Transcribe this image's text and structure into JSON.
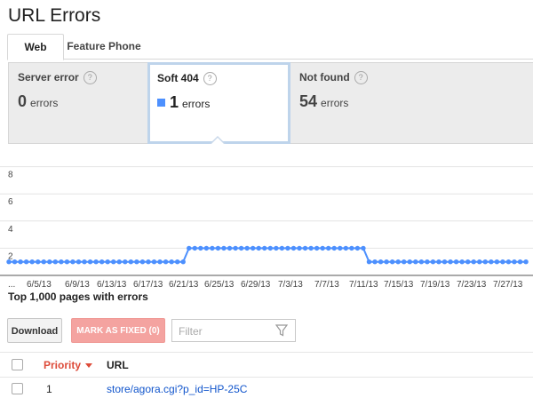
{
  "page": {
    "title": "URL Errors"
  },
  "tabs": [
    {
      "label": "Web",
      "active": true
    },
    {
      "label": "Feature Phone",
      "active": false
    }
  ],
  "summary": [
    {
      "label": "Server error",
      "value": "0",
      "unit": "errors",
      "selected": false
    },
    {
      "label": "Soft 404",
      "value": "1",
      "unit": "errors",
      "selected": true,
      "swatch_color": "#4d90fe"
    },
    {
      "label": "Not found",
      "value": "54",
      "unit": "errors",
      "selected": false
    }
  ],
  "help_glyph": "?",
  "chart_data": {
    "type": "line",
    "title": "",
    "xlabel": "",
    "ylabel": "",
    "ylim": [
      0,
      8
    ],
    "yticks": [
      "2",
      "4",
      "6",
      "8"
    ],
    "yticks_values": [
      2,
      4,
      6,
      8
    ],
    "xtick_labels": [
      "...",
      "6/5/13",
      "6/9/13",
      "6/13/13",
      "6/17/13",
      "6/21/13",
      "6/25/13",
      "6/29/13",
      "7/3/13",
      "7/7/13",
      "7/11/13",
      "7/15/13",
      "7/19/13",
      "7/23/13",
      "7/27/13"
    ],
    "grid": true,
    "color": "#4d90fe",
    "series": [
      {
        "values": [
          1,
          1,
          1,
          1,
          1,
          1,
          1,
          1,
          1,
          1,
          1,
          1,
          1,
          1,
          1,
          1,
          1,
          1,
          1,
          1,
          1,
          1,
          1,
          1,
          1,
          1,
          1,
          1,
          1,
          1,
          1,
          2,
          2,
          2,
          2,
          2,
          2,
          2,
          2,
          2,
          2,
          2,
          2,
          2,
          2,
          2,
          2,
          2,
          2,
          2,
          2,
          2,
          2,
          2,
          2,
          2,
          2,
          2,
          2,
          2,
          2,
          2,
          1,
          1,
          1,
          1,
          1,
          1,
          1,
          1,
          1,
          1,
          1,
          1,
          1,
          1,
          1,
          1,
          1,
          1,
          1,
          1,
          1,
          1,
          1,
          1,
          1,
          1,
          1,
          1
        ]
      }
    ]
  },
  "table": {
    "heading": "Top 1,000 pages with errors",
    "download_label": "Download",
    "mark_fixed_label": "MARK AS FIXED (0)",
    "filter_placeholder": "Filter",
    "columns": {
      "priority": "Priority",
      "url": "URL"
    },
    "rows": [
      {
        "priority": "1",
        "url": "store/agora.cgi?p_id=HP-25C"
      }
    ]
  }
}
